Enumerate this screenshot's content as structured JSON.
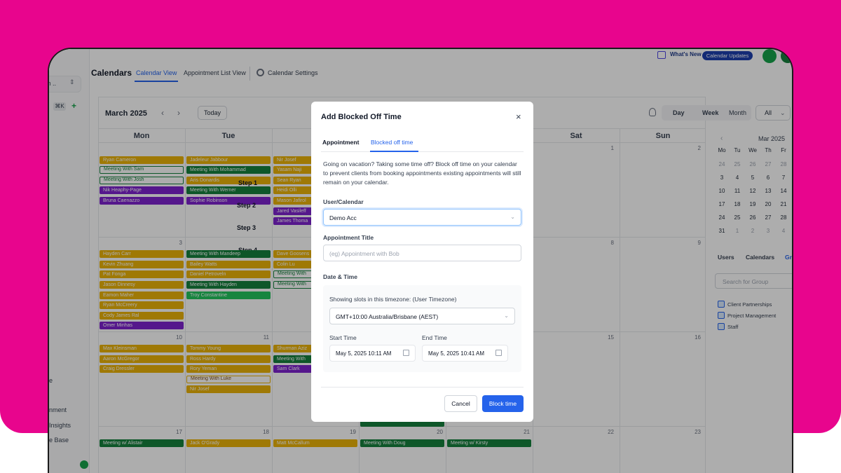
{
  "header": {
    "title": "Calendars",
    "tabs": [
      "Calendar View",
      "Appointment List View"
    ],
    "settings_label": "Calendar Settings",
    "whats_new": "What's New",
    "updates_pill": "Calendar Updates"
  },
  "sidebar": {
    "select_text": "m ..",
    "kbd": "⌘K",
    "items": [
      "e",
      "nment",
      "Insights",
      "e Base"
    ]
  },
  "calendar": {
    "month_title": "March 2025",
    "today": "Today",
    "views": [
      "Day",
      "Week",
      "Month"
    ],
    "filter": "All",
    "days": [
      "Mon",
      "Tue",
      "W",
      "Thu",
      "Fri",
      "Sat",
      "Sun"
    ],
    "day_numbers": [
      "1",
      "2",
      "3",
      "8",
      "9",
      "10",
      "11",
      "15",
      "16",
      "17",
      "18",
      "19",
      "20",
      "21",
      "22",
      "23"
    ],
    "steps": [
      "Step 1",
      "Step 2",
      "Step 3",
      "Step 4"
    ],
    "events": {
      "mon_w1": [
        "Ryan Cameron",
        "Meeting With Sam",
        "Meeting With Josh",
        "Nik Heaphy-Page",
        "Bruna Caenazzo"
      ],
      "tue_w1": [
        "Jadeleur Jabbour",
        "Meeting With Mohammad",
        "Aris Donardis",
        "Meeting With Werner",
        "Sophie Robinson"
      ],
      "wed_w1": [
        "Nir Josef",
        "Yasam Naji",
        "Sean Ryan",
        "Heidi Olli",
        "Mason Jafirol",
        "Jared Vasileff",
        "James Thoma"
      ],
      "mon_w2": [
        "Hayden Carr",
        "Kevin Zhuang",
        "Pat Fonga",
        "Jason Dinnesy",
        "Eamon Maher",
        "Ryan McCreery",
        "Cody James Ral",
        "Omer Minhas"
      ],
      "tue_w2": [
        "Meeting With Mandeep",
        "Bailey Watts",
        "Daniel Petroveln",
        "Meeting With Hayden",
        "Troy Constantine"
      ],
      "wed_w2": [
        "Dave Goosens",
        "Colin Lu",
        "Meeting With",
        "Meeting With"
      ],
      "mon_w3": [
        "Max Kleinsman",
        "Aaron McGregor",
        "Craig Dressler"
      ],
      "tue_w3": [
        "Tommy Young",
        "Ross Hardy",
        "Rory Yeman",
        "Meeting With Luke",
        "Nir Josef"
      ],
      "wed_w3": [
        "Shurman Aziz",
        "Meeting With",
        "Sam Clark"
      ],
      "w4": [
        "Meeting w/ Alistair",
        "Jack O'Grady",
        "Matt McCallum",
        "Meeting With Doug",
        "Meeting w/ Kirsty"
      ]
    }
  },
  "mini_calendar": {
    "title": "Mar 2025",
    "weekdays": [
      "Mo",
      "Tu",
      "We",
      "Th",
      "Fr"
    ],
    "rows": [
      [
        "24",
        "25",
        "26",
        "27",
        "28"
      ],
      [
        "3",
        "4",
        "5",
        "6",
        "7"
      ],
      [
        "10",
        "11",
        "12",
        "13",
        "14"
      ],
      [
        "17",
        "18",
        "19",
        "20",
        "21"
      ],
      [
        "24",
        "25",
        "26",
        "27",
        "28"
      ],
      [
        "31",
        "1",
        "2",
        "3",
        "4"
      ]
    ]
  },
  "right_panel": {
    "tabs": [
      "Users",
      "Calendars",
      "Gro"
    ],
    "search_placeholder": "Search for Group",
    "groups": [
      "Client Partnerships",
      "Project Management",
      "Staff"
    ]
  },
  "modal": {
    "title": "Add Blocked Off Time",
    "close": "×",
    "tabs": [
      "Appointment",
      "Blocked off time"
    ],
    "description": "Going on vacation? Taking some time off? Block off time on your calendar to prevent clients from booking appointments existing appointments will still remain on your calendar.",
    "user_label": "User/Calendar",
    "user_value": "Demo Acc",
    "title_label": "Appointment Title",
    "title_placeholder": "(eg) Appointment with Bob",
    "datetime_label": "Date & Time",
    "tz_label": "Showing slots in this timezone: (User Timezone)",
    "tz_value": "GMT+10:00 Australia/Brisbane (AEST)",
    "start_label": "Start Time",
    "start_value": "May 5, 2025 10:11 AM",
    "end_label": "End Time",
    "end_value": "May 5, 2025 10:41 AM",
    "cancel": "Cancel",
    "submit": "Block time"
  }
}
